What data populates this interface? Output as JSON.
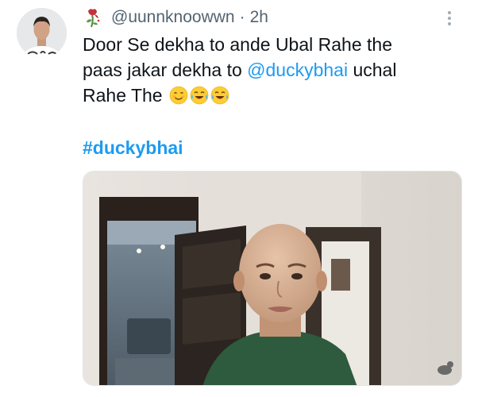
{
  "tweet": {
    "handle": "@uunnknoowwn",
    "separator": "·",
    "timestamp": "2h",
    "text_line1": "Door Se dekha to ande Ubal Rahe the",
    "text_line2_pre": "paas jakar dekha to ",
    "mention": "@duckybhai",
    "text_line2_post": " uchal",
    "text_line3": "Rahe The",
    "hashtag": "#duckybhai"
  },
  "icons": {
    "name_emoji": "wilted-rose-icon",
    "menu": "more-options-icon",
    "emojis": [
      "smiling-face-icon",
      "tears-of-joy-icon",
      "tears-of-joy-icon"
    ]
  },
  "colors": {
    "link": "#1d9bf0",
    "secondary_text": "#536471",
    "primary_text": "#0f1419"
  }
}
